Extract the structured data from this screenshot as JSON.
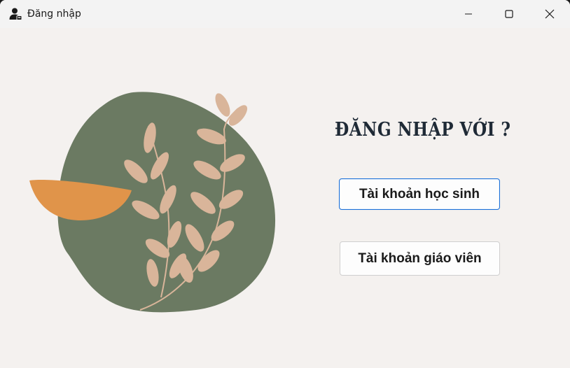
{
  "window": {
    "title": "Đăng nhập",
    "icon": "user-login-icon",
    "controls": [
      "minimize-icon",
      "maximize-icon",
      "close-icon"
    ]
  },
  "main": {
    "heading": "ĐĂNG NHẬP VỚI ?",
    "buttons": {
      "student": "Tài khoản học sinh",
      "teacher": "Tài khoản giáo viên"
    }
  },
  "colors": {
    "background": "#f4f1ef",
    "blob": "#6b7a62",
    "leaf": "#d9b59a",
    "bowl": "#e0944a",
    "focus_border": "#1a6fd8"
  }
}
